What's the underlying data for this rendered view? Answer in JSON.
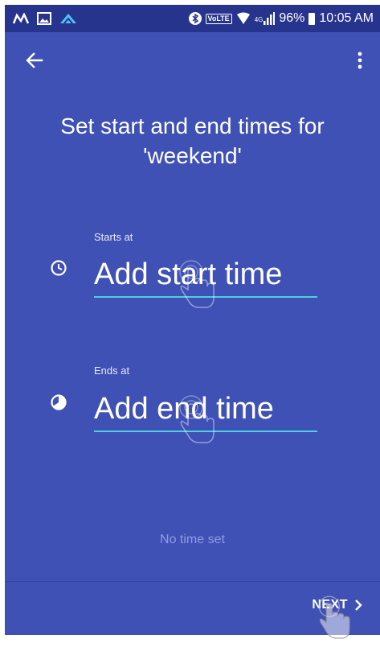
{
  "status_bar": {
    "left_icons": [
      "maps-icon",
      "gallery-icon",
      "app-icon"
    ],
    "volte": "VoLTE",
    "network": "4G",
    "battery": "96%",
    "time": "10:05 AM"
  },
  "toolbar": {
    "back_icon": "arrow-back-icon",
    "menu_icon": "more-vert-icon"
  },
  "title": "Set start and end times for 'weekend'",
  "start": {
    "label": "Starts at",
    "placeholder": "Add start time",
    "icon": "clock-icon"
  },
  "end": {
    "label": "Ends at",
    "placeholder": "Add end time",
    "icon": "clock-filled-icon"
  },
  "status_text": "No time set",
  "footer": {
    "next_label": "NEXT",
    "next_icon": "chevron-right-icon"
  },
  "colors": {
    "background": "#3f51b5",
    "status_bar": "#26348e",
    "accent_underline": "#4dd0e1",
    "muted_text": "#8f9be0"
  }
}
